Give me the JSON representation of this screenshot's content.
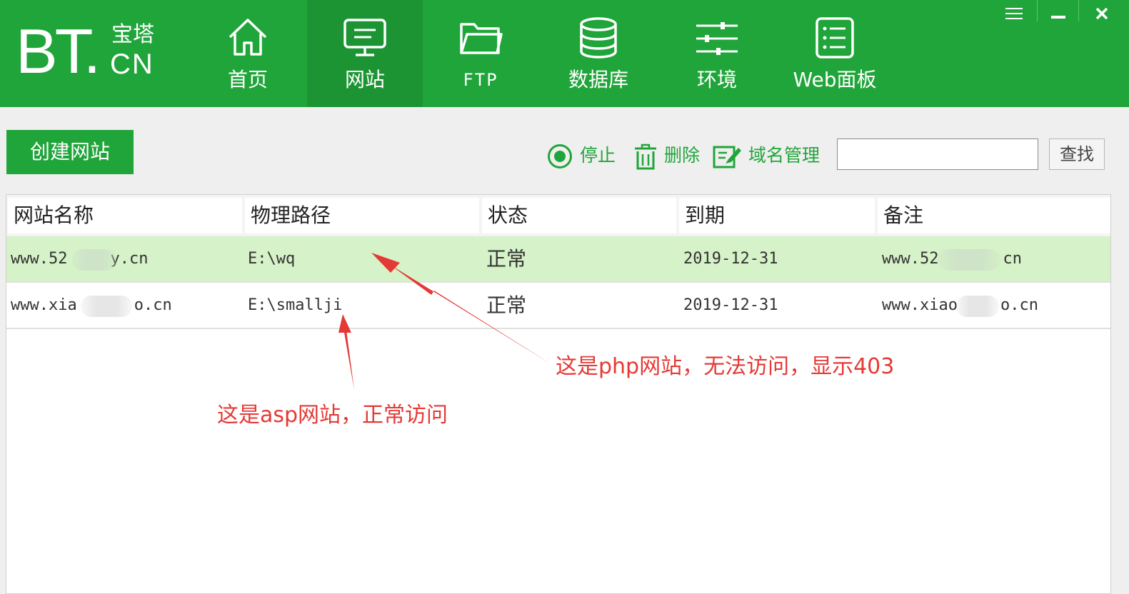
{
  "header": {
    "logo": {
      "main": "BT.",
      "top": "宝塔",
      "bottom": "CN"
    },
    "nav": [
      {
        "label": "首页",
        "icon": "home-icon"
      },
      {
        "label": "网站",
        "icon": "monitor-icon",
        "active": true
      },
      {
        "label": "FTP",
        "icon": "folder-icon"
      },
      {
        "label": "数据库",
        "icon": "database-icon"
      },
      {
        "label": "环境",
        "icon": "sliders-icon"
      },
      {
        "label": "Web面板",
        "icon": "list-panel-icon"
      }
    ],
    "window_controls": [
      "menu-icon",
      "minimize-icon",
      "close-icon"
    ]
  },
  "toolbar": {
    "create_label": "创建网站",
    "stop_label": "停止",
    "delete_label": "删除",
    "domain_label": "域名管理",
    "search_value": "",
    "search_button": "查找"
  },
  "table": {
    "columns": [
      "网站名称",
      "物理路径",
      "状态",
      "到期",
      "备注"
    ],
    "rows": [
      {
        "name_pre": "www.52",
        "name_post": "y.cn",
        "path": "E:\\wq",
        "status": "正常",
        "expire": "2019-12-31",
        "note_pre": "www.52",
        "note_post": "cn",
        "selected": true
      },
      {
        "name_pre": "www.xia",
        "name_post": "o.cn",
        "path": "E:\\smallji",
        "status": "正常",
        "expire": "2019-12-31",
        "note_pre": "www.xiao",
        "note_post": "o.cn",
        "selected": false
      }
    ]
  },
  "annotations": {
    "php": "这是php网站，无法访问，显示403",
    "asp": "这是asp网站，正常访问"
  },
  "colors": {
    "brand": "#20a53a",
    "brand_dark": "#1d9433",
    "selected_row": "#d6f2c8",
    "annotation": "#e53935"
  }
}
